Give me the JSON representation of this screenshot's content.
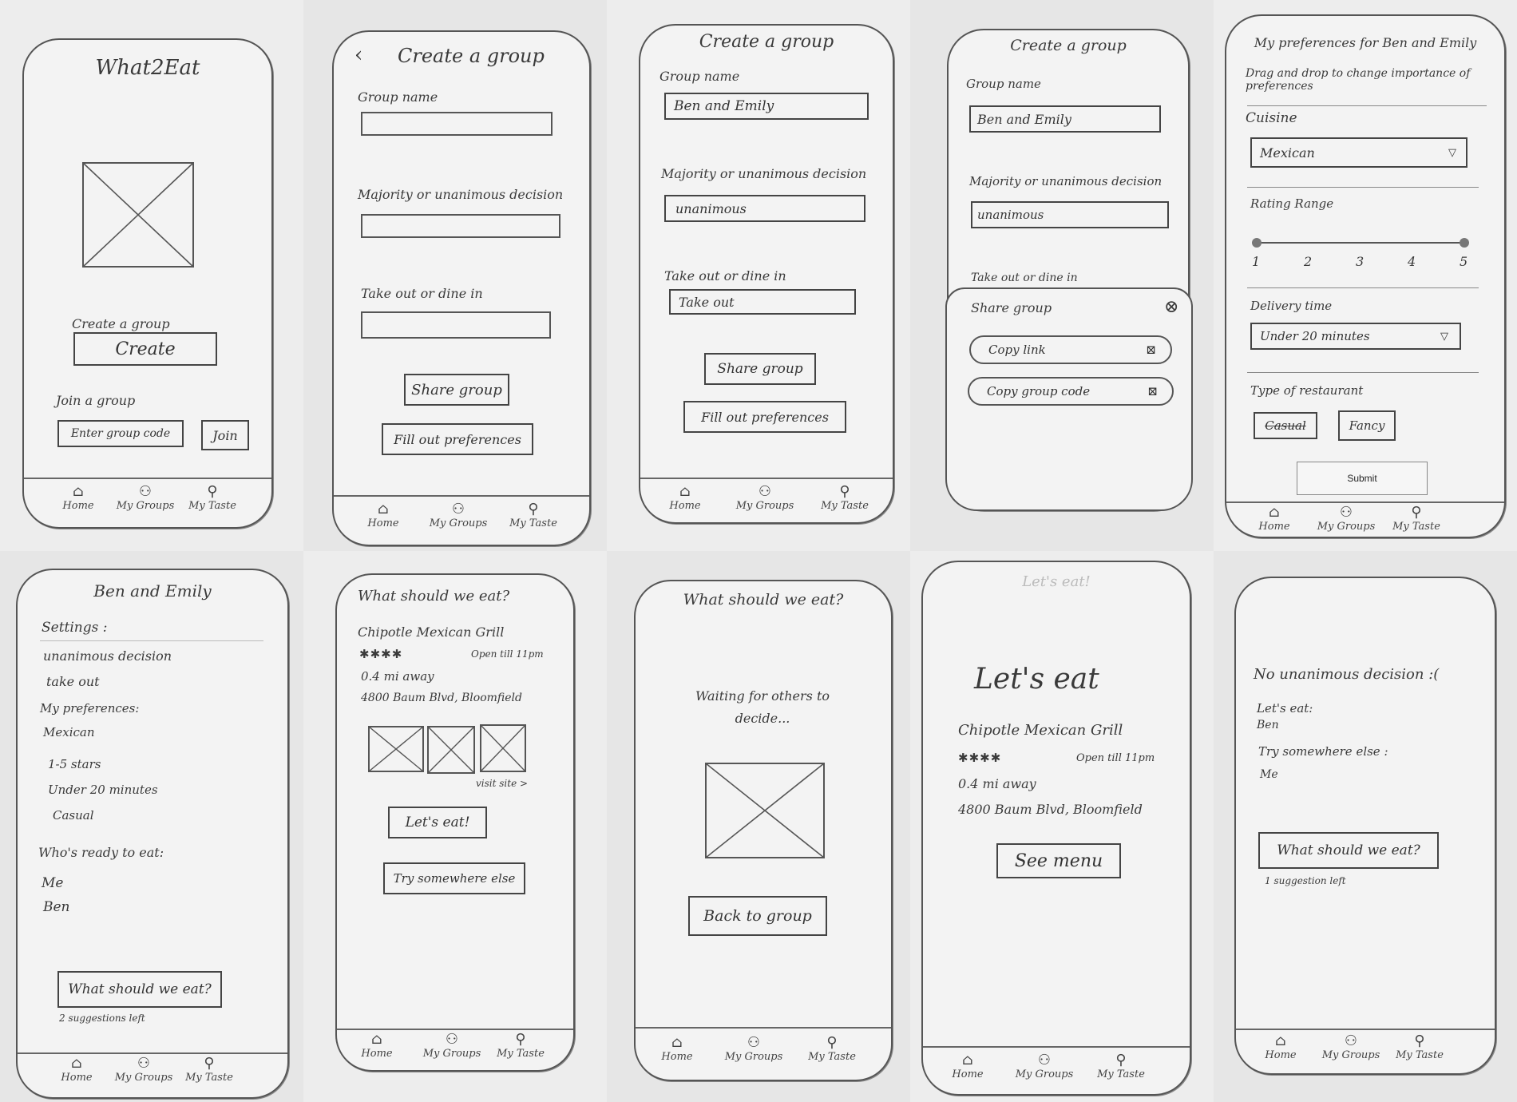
{
  "screens": {
    "s1": {
      "title": "What2Eat",
      "create_label": "Create a group",
      "create_button": "Create",
      "join_label": "Join a group",
      "join_placeholder": "Enter group code",
      "join_button": "Join"
    },
    "s2": {
      "title": "Create a group",
      "group_name_label": "Group name",
      "decision_label": "Majority or unanimous decision",
      "takeout_label": "Take out or dine in",
      "share_button": "Share group",
      "prefs_button": "Fill out preferences"
    },
    "s3": {
      "title": "Create a group",
      "group_name_label": "Group name",
      "group_name_value": "Ben and Emily",
      "decision_label": "Majority or unanimous decision",
      "decision_value": "unanimous",
      "takeout_label": "Take out or dine in",
      "takeout_value": "Take out",
      "share_button": "Share group",
      "prefs_button": "Fill out preferences"
    },
    "s4": {
      "title": "Create a group",
      "group_name_label": "Group name",
      "group_name_value": "Ben and Emily",
      "decision_label": "Majority or unanimous decision",
      "decision_value": "unanimous",
      "takeout_label": "Take out or dine in",
      "modal_title": "Share group",
      "copy_link": "Copy link",
      "copy_code": "Copy group code"
    },
    "s5": {
      "title": "My preferences for Ben and Emily",
      "instruction": "Drag and drop to change importance of preferences",
      "cuisine_label": "Cuisine",
      "cuisine_value": "Mexican",
      "rating_label": "Rating Range",
      "rating_ticks": [
        "1",
        "2",
        "3",
        "4",
        "5"
      ],
      "rating_min": 1,
      "rating_max": 5,
      "delivery_label": "Delivery time",
      "delivery_value": "Under 20 minutes",
      "type_label": "Type of restaurant",
      "type_options": [
        "Casual",
        "Fancy"
      ],
      "submit_button": "Submit"
    },
    "s6": {
      "title": "Ben and Emily",
      "settings_label": "Settings :",
      "setting_1": "unanimous decision",
      "setting_2": "take out",
      "prefs_label": "My preferences:",
      "pref_1": "Mexican",
      "pref_2": "1-5 stars",
      "pref_3": "Under 20 minutes",
      "pref_4": "Casual",
      "ready_label": "Who's ready to eat:",
      "ready_1": "Me",
      "ready_2": "Ben",
      "eat_button": "What should we eat?",
      "suggestions": "2 suggestions left"
    },
    "s7": {
      "title": "What should we eat?",
      "restaurant": "Chipotle Mexican Grill",
      "stars": "✱✱✱✱",
      "hours": "Open till 11pm",
      "distance": "0.4 mi away",
      "address": "4800 Baum Blvd, Bloomfield",
      "visit_site": "visit site >",
      "lets_eat_button": "Let's eat!",
      "try_else_button": "Try somewhere else"
    },
    "s8": {
      "title": "What should we eat?",
      "waiting": "Waiting for others to decide...",
      "back_button": "Back to group"
    },
    "s9": {
      "faint_title": "Let's eat!",
      "heading": "Let's eat",
      "restaurant": "Chipotle Mexican Grill",
      "stars": "✱✱✱✱",
      "hours": "Open till 11pm",
      "distance": "0.4 mi away",
      "address": "4800 Baum Blvd, Bloomfield",
      "menu_button": "See menu"
    },
    "s10": {
      "heading": "No unanimous decision :(",
      "lets_eat_label": "Let's eat:",
      "lets_eat_name": "Ben",
      "try_label": "Try somewhere else :",
      "try_name": "Me",
      "eat_button": "What should we eat?",
      "suggestions": "1 suggestion left"
    }
  },
  "nav": {
    "home": "Home",
    "groups": "My Groups",
    "taste": "My Taste"
  },
  "icons": {
    "home": "home-icon",
    "groups": "groups-icon",
    "taste": "person-icon",
    "placeholder": "image-placeholder-icon",
    "dropdown": "dropdown-triangle-icon",
    "close": "close-icon",
    "copy": "copy-icon",
    "back": "back-chevron-icon"
  }
}
